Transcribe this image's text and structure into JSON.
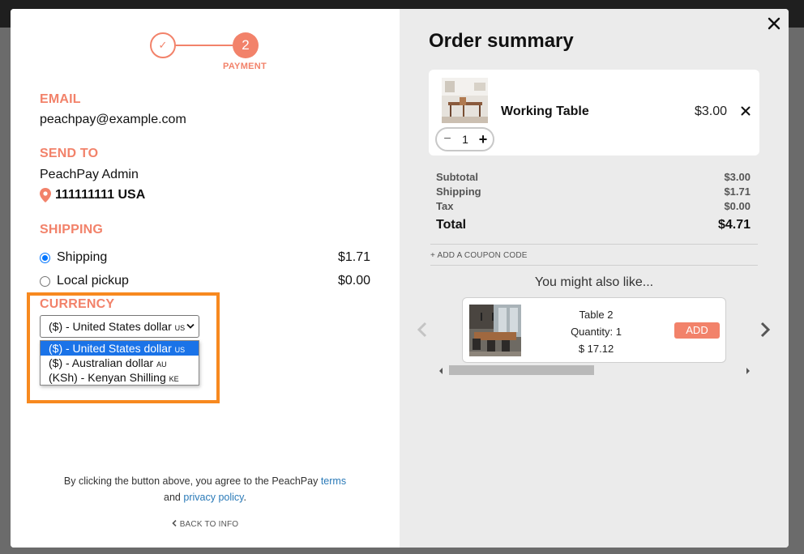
{
  "checkout": {
    "steps": {
      "step1_glyph": "✓",
      "step2_number": "2",
      "step2_label": "PAYMENT"
    },
    "email": {
      "title": "EMAIL",
      "value": "peachpay@example.com"
    },
    "send_to": {
      "title": "SEND TO",
      "name": "PeachPay Admin",
      "address": "111111111 USA"
    },
    "shipping": {
      "title": "SHIPPING",
      "options": [
        {
          "label": "Shipping",
          "price": "$1.71",
          "selected": true
        },
        {
          "label": "Local pickup",
          "price": "$0.00",
          "selected": false
        }
      ]
    },
    "currency": {
      "title": "CURRENCY",
      "selected_label": "($) - United States dollar",
      "selected_code": "US",
      "options": [
        {
          "label": "($) - United States dollar",
          "code": "US"
        },
        {
          "label": "($) - Australian dollar",
          "code": "AU"
        },
        {
          "label": "(KSh) - Kenyan Shilling",
          "code": "KE"
        }
      ],
      "highlight_color": "#f7891f"
    },
    "legal": {
      "prefix": "By clicking the button above, you agree to the PeachPay",
      "terms": "terms",
      "and": "and",
      "privacy": "privacy policy",
      "suffix": "."
    },
    "back_link": "BACK TO INFO"
  },
  "summary": {
    "title": "Order summary",
    "item": {
      "name": "Working Table",
      "price": "$3.00",
      "quantity": "1"
    },
    "totals": {
      "subtotal_label": "Subtotal",
      "subtotal": "$3.00",
      "shipping_label": "Shipping",
      "shipping": "$1.71",
      "tax_label": "Tax",
      "tax": "$0.00",
      "total_label": "Total",
      "total": "$4.71"
    },
    "coupon_link": "+ ADD A COUPON CODE",
    "recommendations": {
      "heading": "You might also like...",
      "product_name": "Table 2",
      "quantity": "Quantity: 1",
      "price": "$ 17.12",
      "add_label": "ADD"
    }
  },
  "colors": {
    "accent": "#f2826a",
    "link": "#2a7ab8",
    "radio_selected": "#0075ff",
    "dropdown_active": "#1a73e8"
  }
}
